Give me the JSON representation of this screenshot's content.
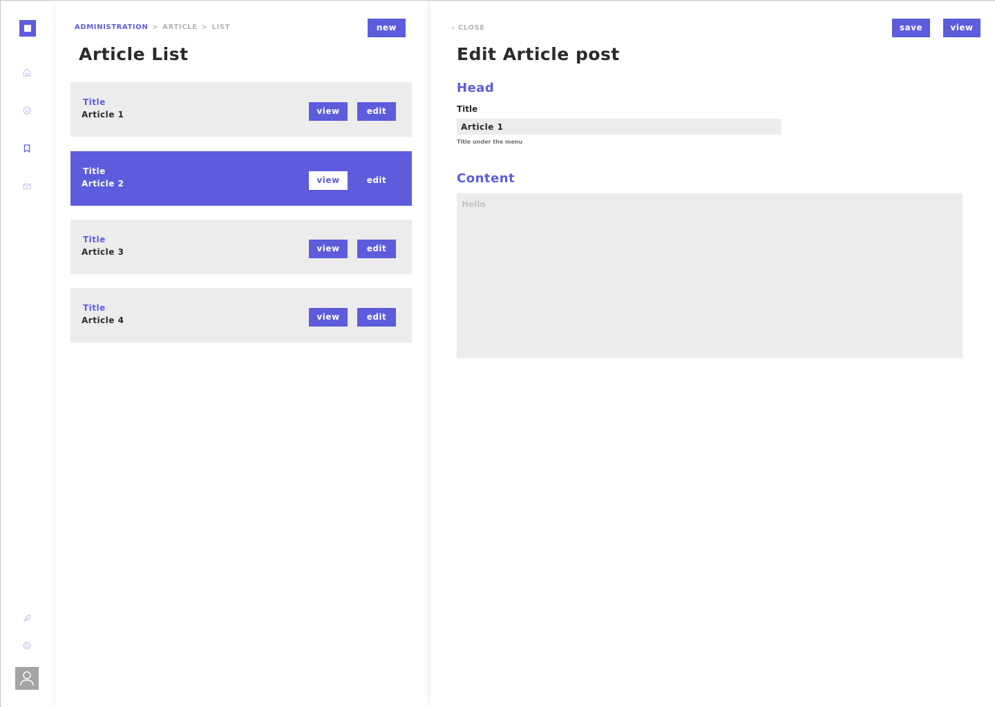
{
  "colors": {
    "accent": "#5c5cdc",
    "card_bg": "#ececec",
    "muted": "#b4b4b4",
    "avatar": "#a4a4a4"
  },
  "sidebar": {
    "logo": "app-logo",
    "nav": [
      {
        "icon": "home-icon",
        "label": ""
      },
      {
        "icon": "smiley-icon",
        "label": ""
      },
      {
        "icon": "bookmark-icon",
        "label": ""
      },
      {
        "icon": "mail-icon",
        "label": ""
      }
    ],
    "bottom": [
      {
        "icon": "feather-icon"
      },
      {
        "icon": "gear-icon"
      }
    ],
    "avatar_icon": "user-icon"
  },
  "list_panel": {
    "breadcrumb": [
      "ADMINISTRATION",
      "ARTICLE",
      "LIST"
    ],
    "breadcrumb_separator": ">",
    "new_label": "new",
    "title": "Article List",
    "cards": [
      {
        "label": "Title",
        "name": "Article 1",
        "view": "view",
        "edit": "edit",
        "active": false
      },
      {
        "label": "Title",
        "name": "Article 2",
        "view": "view",
        "edit": "edit",
        "active": true
      },
      {
        "label": "Title",
        "name": "Article 3",
        "view": "view",
        "edit": "edit",
        "active": false
      },
      {
        "label": "Title",
        "name": "Article 4",
        "view": "view",
        "edit": "edit",
        "active": false
      }
    ]
  },
  "edit_panel": {
    "close_label": "CLOSE",
    "save_label": "save",
    "view_label": "view",
    "title": "Edit Article post",
    "head_section": "Head",
    "title_field_label": "Title",
    "title_field_value": "Article 1",
    "title_field_hint": "Title under the menu",
    "content_section": "Content",
    "content_placeholder": "Hello"
  }
}
